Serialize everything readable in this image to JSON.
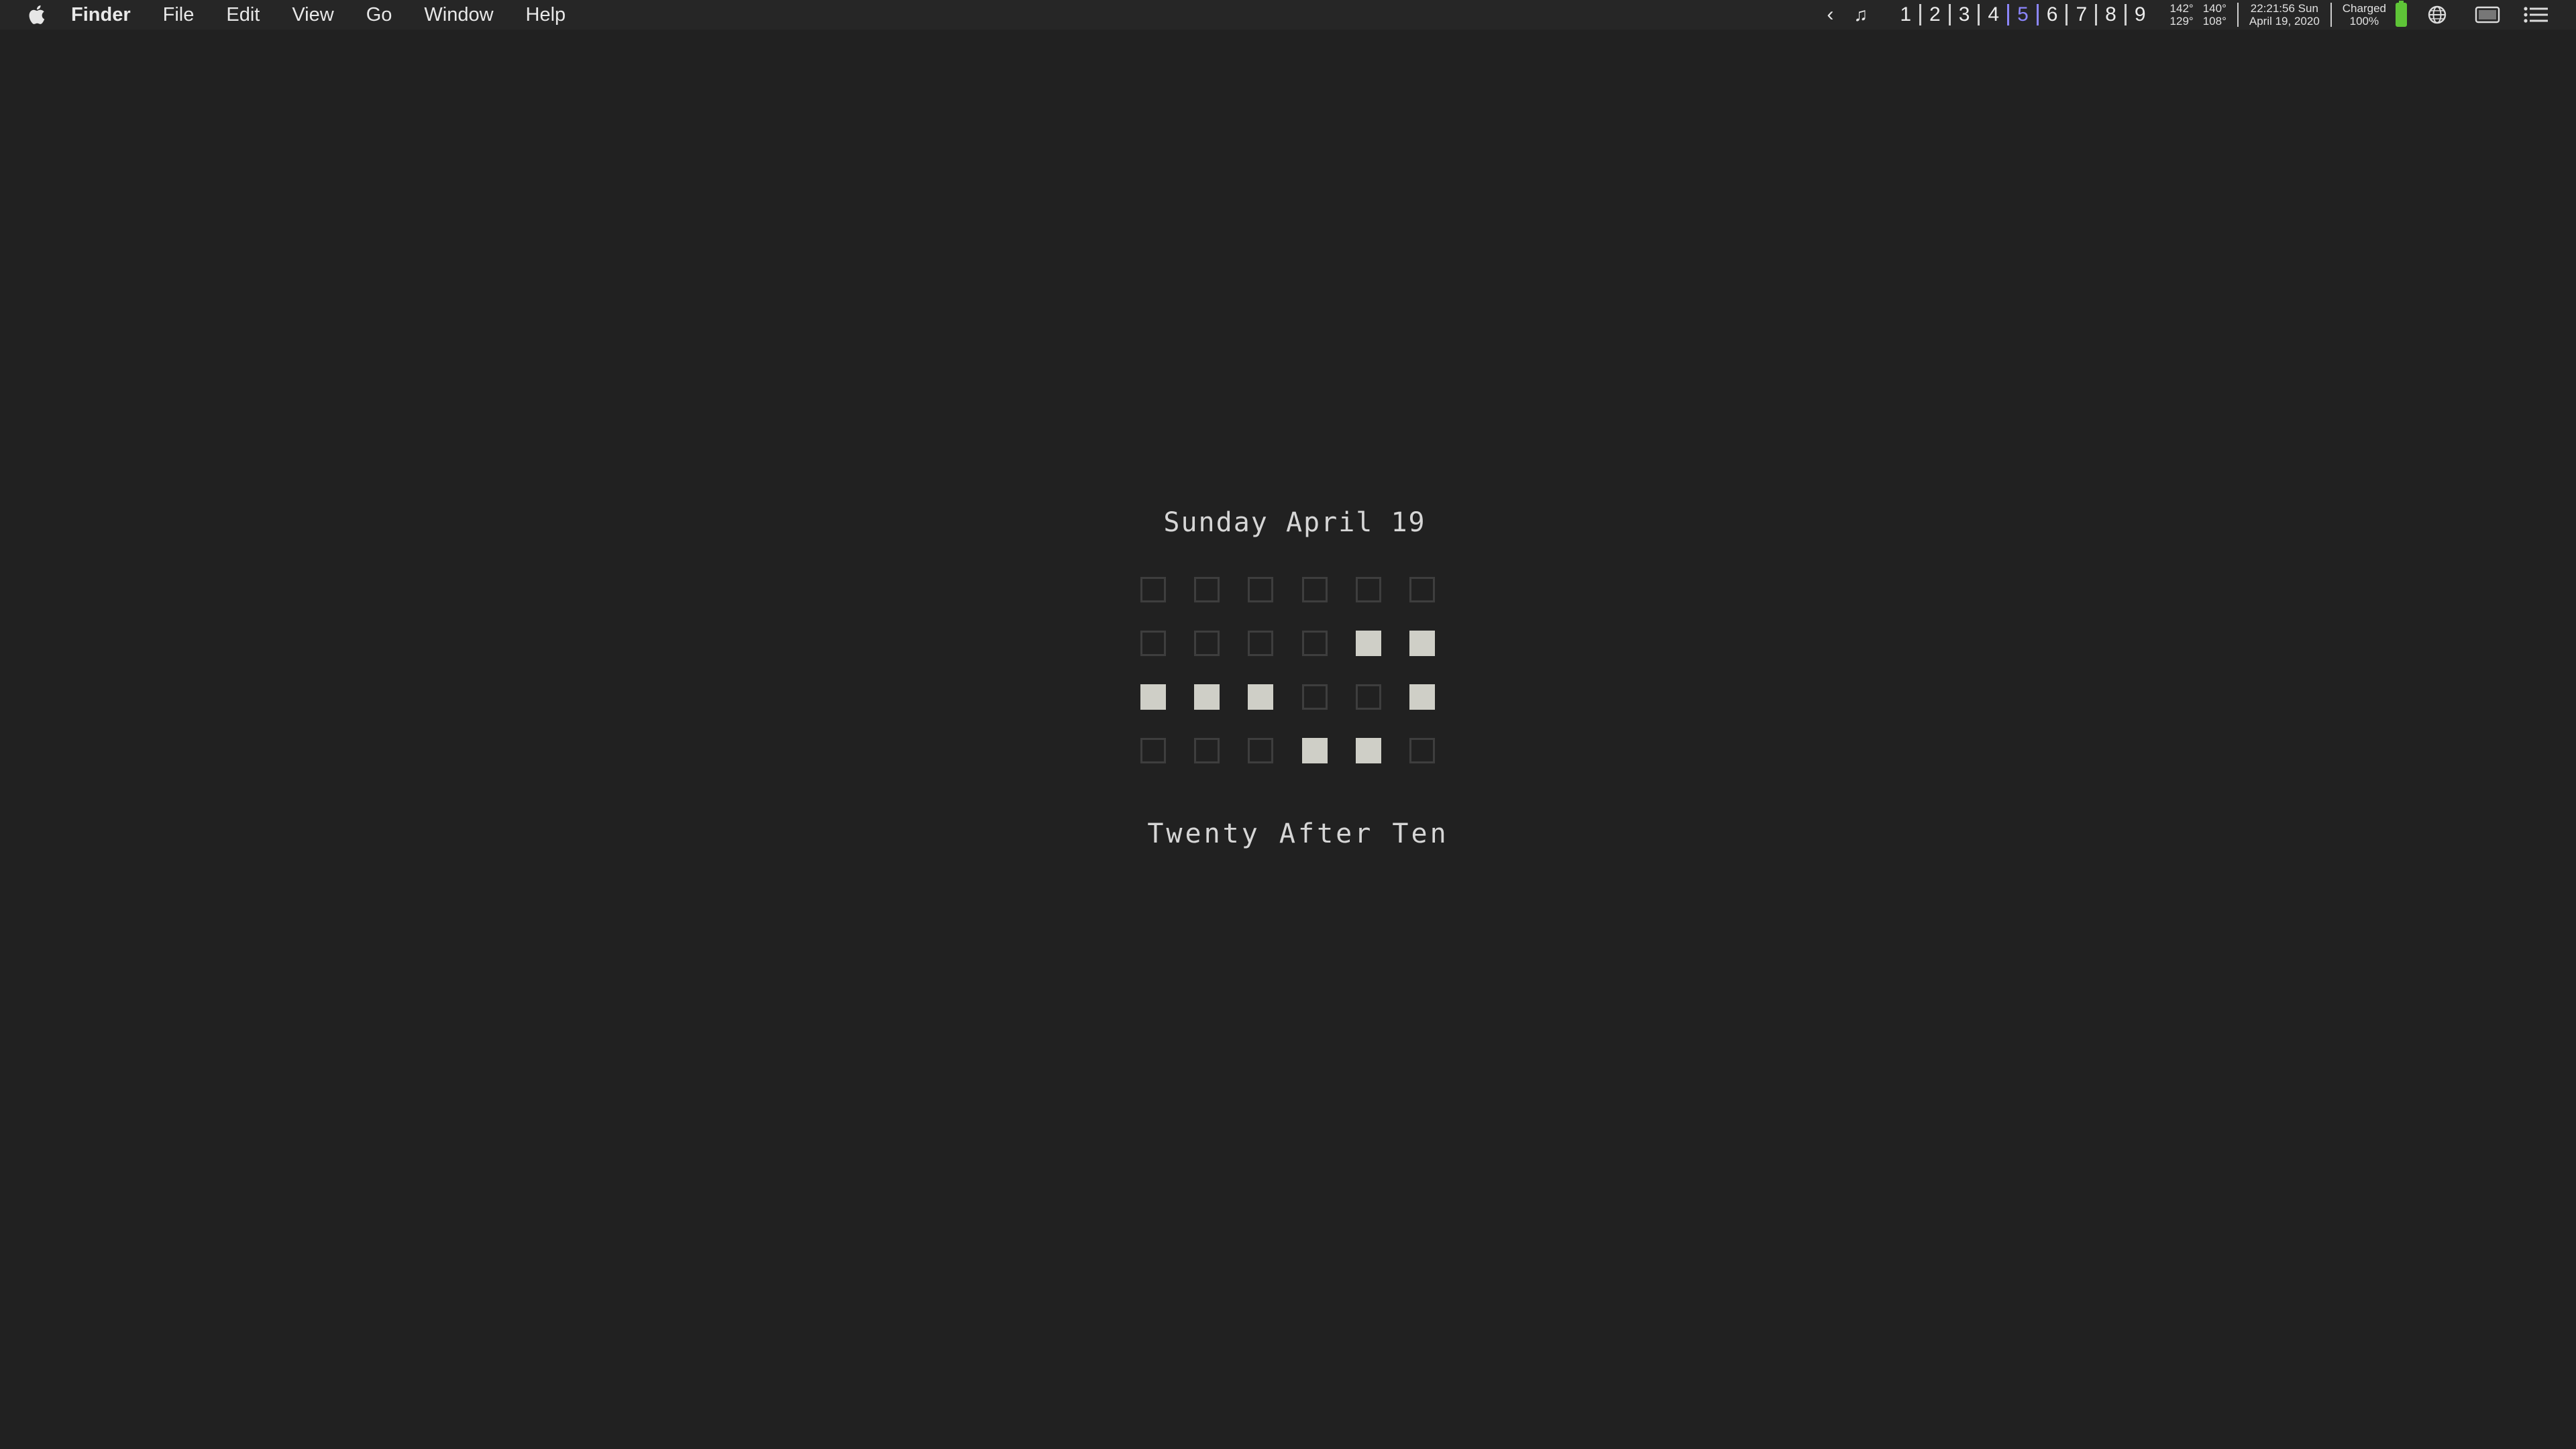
{
  "menubar": {
    "app_name": "Finder",
    "items": [
      "File",
      "Edit",
      "View",
      "Go",
      "Window",
      "Help"
    ]
  },
  "status": {
    "chevron": "‹",
    "music_icon": "music-note-icon",
    "spaces": [
      "1",
      "2",
      "3",
      "4",
      "5",
      "6",
      "7",
      "8",
      "9"
    ],
    "active_space": "5",
    "temps": [
      "142°",
      "140°",
      "129°",
      "108°"
    ],
    "clock_time": "22:21:56 Sun",
    "clock_date": "April 19, 2020",
    "power_state": "Charged",
    "power_percent": "100%",
    "battery_level": 1.0,
    "colors": {
      "accent": "#8c86ff",
      "battery": "#5ec437"
    }
  },
  "widget": {
    "date": "Sunday April 19",
    "time_words": "Twenty After Ten",
    "grid_rows": [
      [
        0,
        0,
        0,
        0,
        0,
        0
      ],
      [
        0,
        0,
        0,
        0,
        1,
        1
      ],
      [
        1,
        1,
        1,
        0,
        0,
        1
      ],
      [
        0,
        0,
        0,
        1,
        1,
        0
      ]
    ],
    "colors": {
      "background": "#212121",
      "cell_on": "#cfcfc7",
      "cell_off_border": "#3e3e3e"
    }
  }
}
